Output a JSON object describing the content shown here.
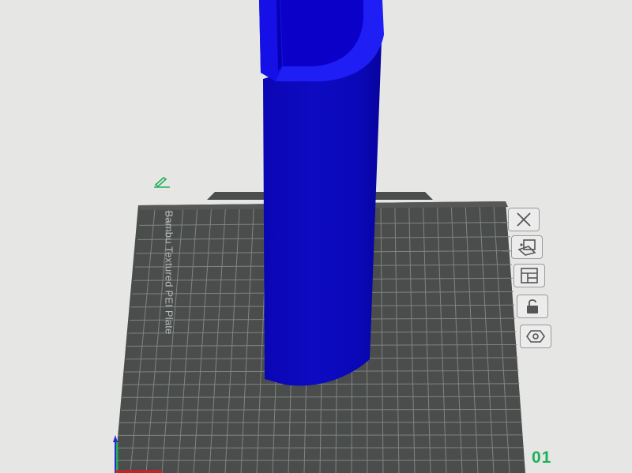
{
  "plate": {
    "label": "Bambu Textured PEI Plate",
    "number": "01"
  },
  "colors": {
    "background": "#e6e6e4",
    "plate": "#4a4d4c",
    "grid": "#7f8483",
    "model": "#0a00c8",
    "model_top": "#1e1ef5",
    "accent_green": "#1fb05a"
  },
  "plate_tools": [
    {
      "name": "close-plate-icon"
    },
    {
      "name": "orient-plate-icon"
    },
    {
      "name": "arrange-plate-icon"
    },
    {
      "name": "lock-plate-icon"
    },
    {
      "name": "plate-settings-icon"
    }
  ]
}
